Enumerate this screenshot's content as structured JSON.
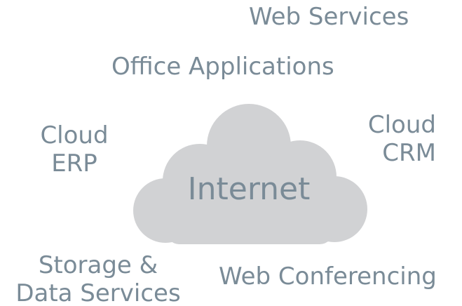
{
  "diagram": {
    "center_label": "Internet",
    "services": {
      "web_services": "Web Services",
      "office_applications": "Office Applications",
      "cloud_erp": [
        "Cloud",
        "ERP"
      ],
      "cloud_crm": [
        "Cloud",
        "CRM"
      ],
      "storage_data": [
        "Storage &",
        "Data Services"
      ],
      "web_conferencing": "Web Conferencing"
    },
    "colors": {
      "cloud_fill": "#d1d2d4",
      "text": "#7a8b97"
    }
  }
}
